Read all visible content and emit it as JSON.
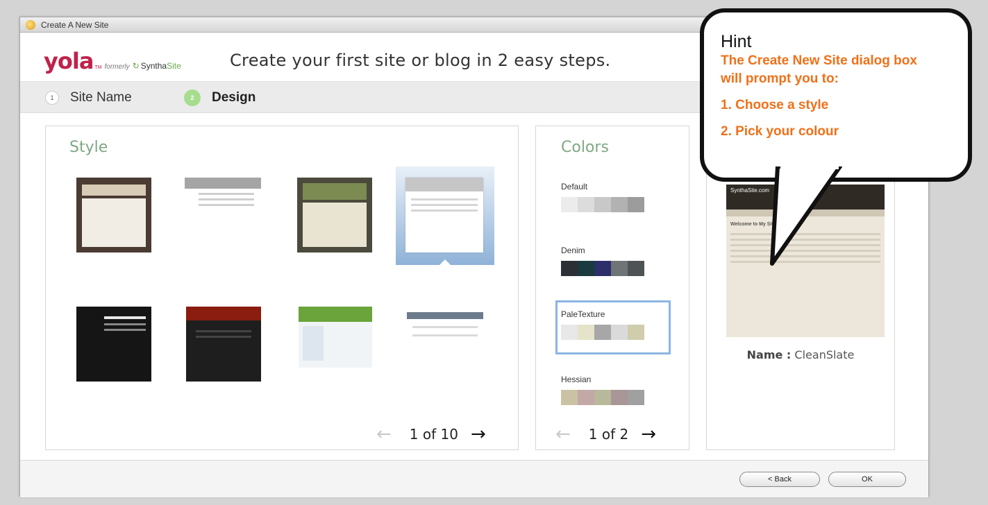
{
  "window": {
    "title": "Create A New Site"
  },
  "header": {
    "logo": {
      "name": "yola",
      "tm": "TM",
      "formerly": "formerly",
      "brand_a": "Syntha",
      "brand_b": "Site"
    },
    "headline": "Create your first site or blog in 2 easy steps."
  },
  "steps": [
    {
      "num": "1",
      "label": "Site Name"
    },
    {
      "num": "2",
      "label": "Design"
    }
  ],
  "style_panel": {
    "title": "Style",
    "pager": "1 of 10",
    "thumbnails": [
      {
        "name": "style-thumbnail-1",
        "palette": [
          "#4a3b33",
          "#f2ede4"
        ]
      },
      {
        "name": "style-thumbnail-2",
        "palette": [
          "#ffffff",
          "#bfbfbf"
        ]
      },
      {
        "name": "style-thumbnail-3",
        "palette": [
          "#4b4a3c",
          "#e9e4d2"
        ]
      },
      {
        "name": "style-thumbnail-4-selected",
        "palette": [
          "#ffffff",
          "#c9c9c9"
        ]
      },
      {
        "name": "style-thumbnail-5",
        "palette": [
          "#151515",
          "#e6e6e6"
        ]
      },
      {
        "name": "style-thumbnail-6",
        "palette": [
          "#1e1e1e",
          "#8a1c10"
        ]
      },
      {
        "name": "style-thumbnail-7",
        "palette": [
          "#6aa43a",
          "#f1f4f7"
        ]
      },
      {
        "name": "style-thumbnail-8",
        "palette": [
          "#ffffff",
          "#6b7b8c"
        ]
      }
    ]
  },
  "colors_panel": {
    "title": "Colors",
    "pager": "1 of 2",
    "items": [
      {
        "label": "Default",
        "swatches": [
          "#ececec",
          "#dcdcdc",
          "#c8c8c8",
          "#b2b2b2",
          "#9c9c9c"
        ]
      },
      {
        "label": "Denim",
        "swatches": [
          "#2c2f35",
          "#1a3a3f",
          "#2c2f6a",
          "#6f7477",
          "#4e5356"
        ]
      },
      {
        "label": "PaleTexture",
        "swatches": [
          "#e8e8e8",
          "#e5e3c9",
          "#a7a7a7",
          "#dadada",
          "#d0cdac"
        ]
      },
      {
        "label": "Hessian",
        "swatches": [
          "#c9c3a3",
          "#c2a9a7",
          "#b8b89a",
          "#a99696",
          "#a0a0a0"
        ]
      }
    ]
  },
  "preview_panel": {
    "site_header": "SynthaSite.com",
    "heading": "Welcome to My Site",
    "name_label": "Name :",
    "name_value": "CleanSlate"
  },
  "footer": {
    "back_label": "< Back",
    "ok_label": "OK"
  },
  "hint": {
    "title": "Hint",
    "lines": [
      "The Create New Site dialog box",
      "will prompt you to:",
      "1. Choose a style",
      "2. Pick your colour"
    ],
    "accent": "#f07018"
  }
}
